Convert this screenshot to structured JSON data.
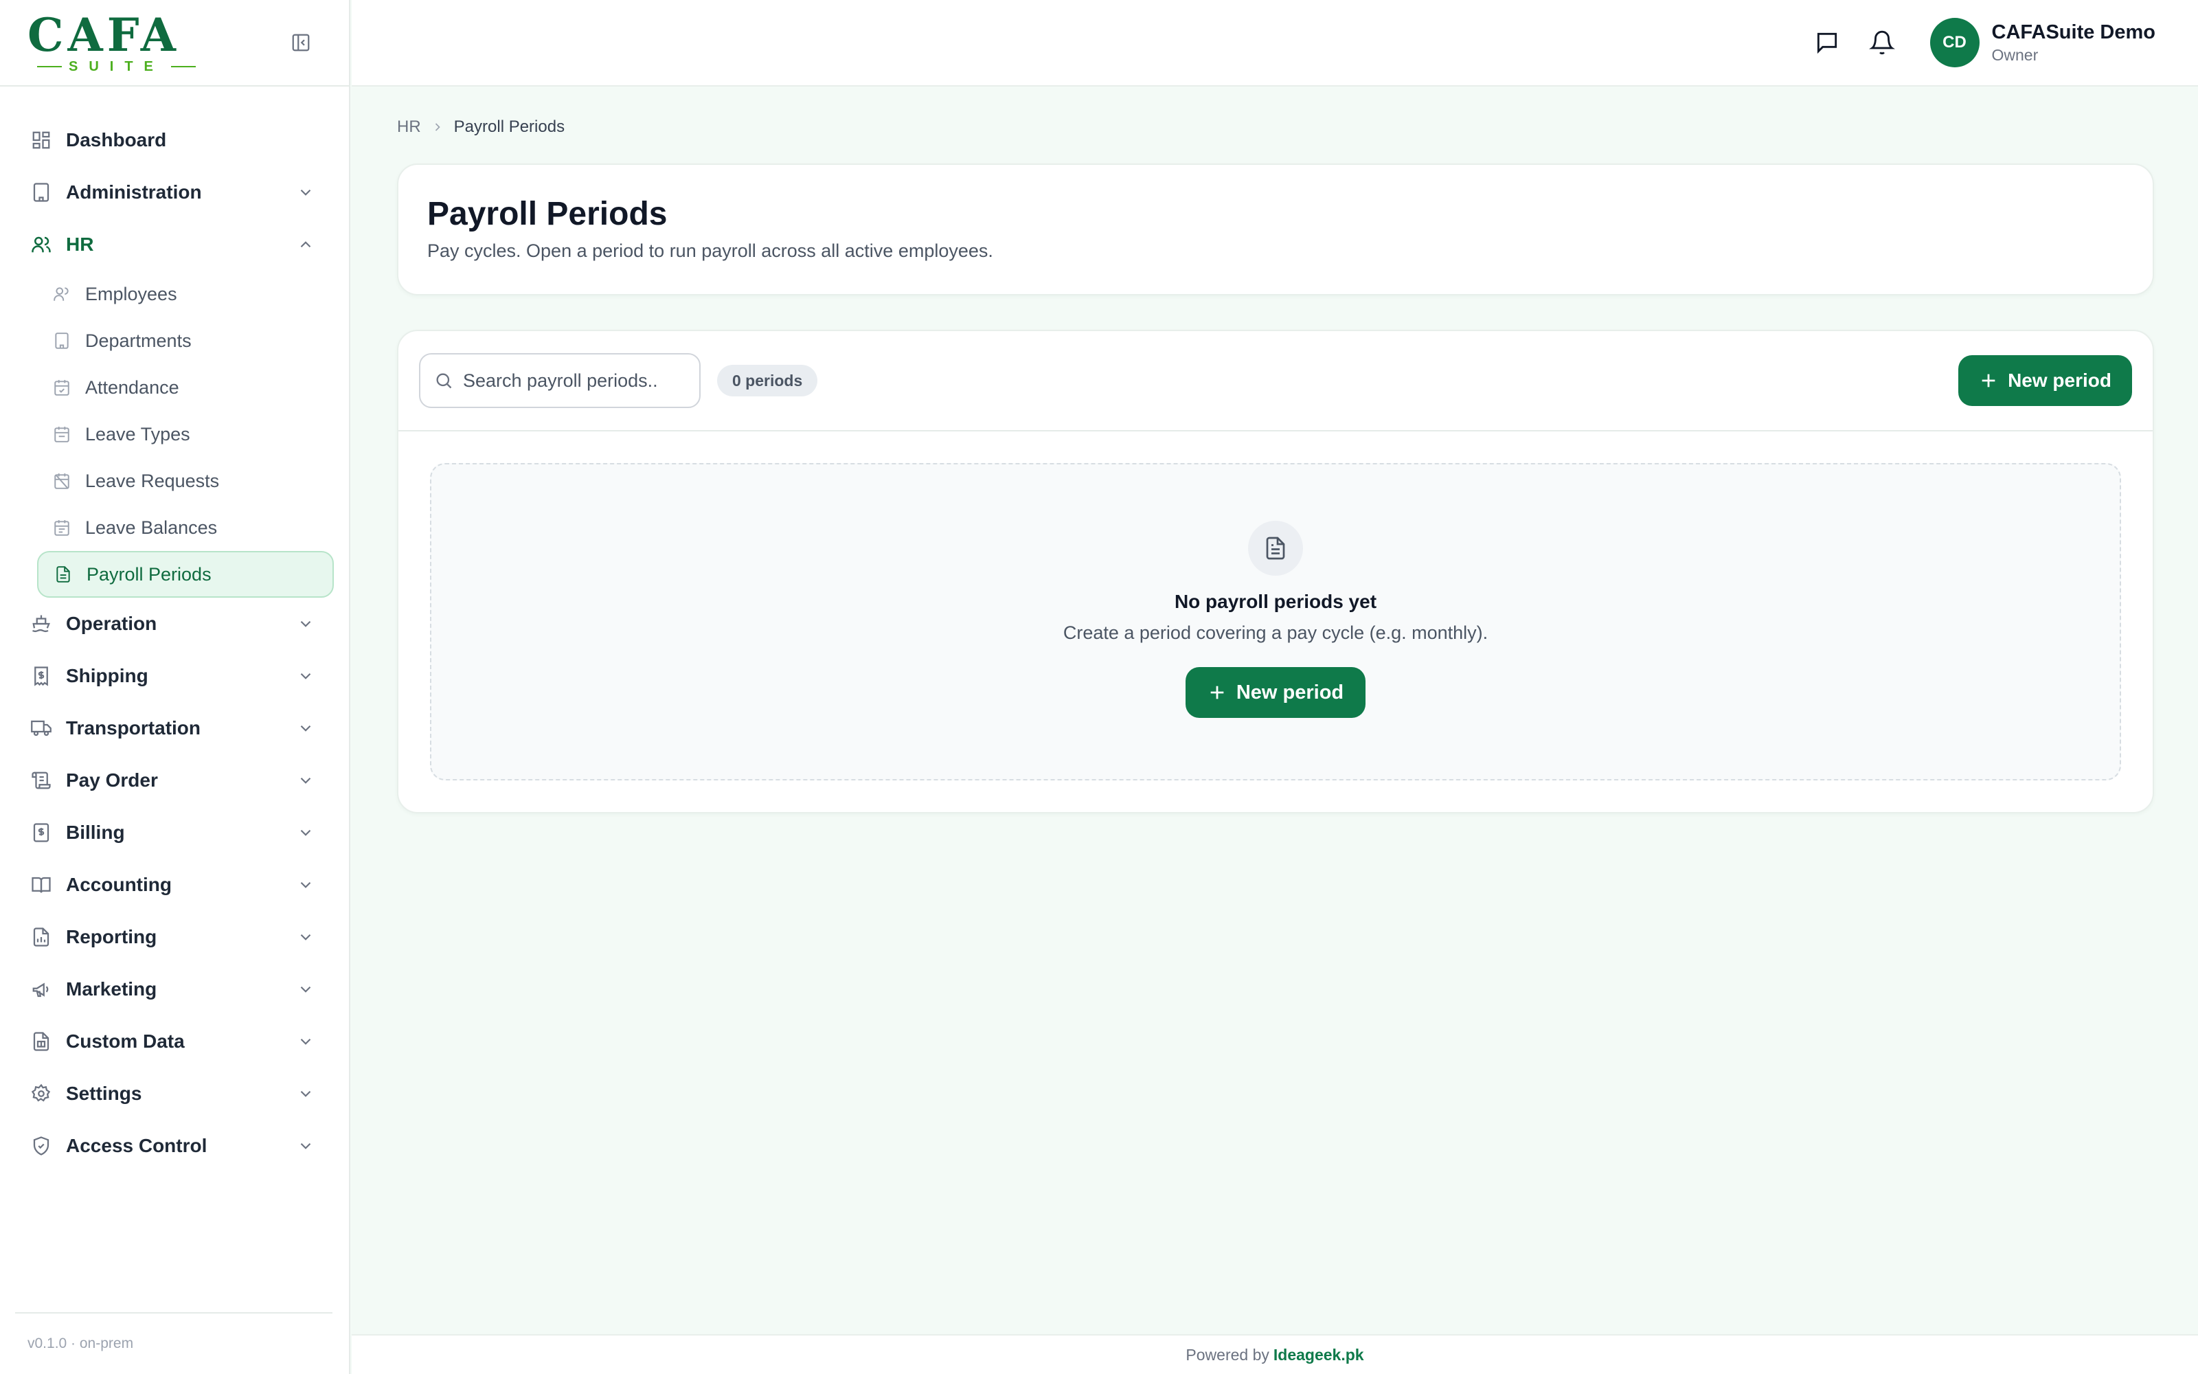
{
  "brand": {
    "logo_text": "CAFA",
    "logo_subtext": "SUITE",
    "accent": "#0f7a4a"
  },
  "sidebar": {
    "collapse_icon": "sidebar-collapse-icon",
    "items": [
      {
        "label": "Dashboard",
        "icon": "dashboard-icon"
      },
      {
        "label": "Administration",
        "icon": "building-icon"
      },
      {
        "label": "HR",
        "icon": "users-icon",
        "expanded": true,
        "children": [
          {
            "label": "Employees",
            "icon": "user-icon"
          },
          {
            "label": "Departments",
            "icon": "building-icon"
          },
          {
            "label": "Attendance",
            "icon": "calendar-check-icon"
          },
          {
            "label": "Leave Types",
            "icon": "calendar-icon"
          },
          {
            "label": "Leave Requests",
            "icon": "calendar-off-icon"
          },
          {
            "label": "Leave Balances",
            "icon": "calendar-icon"
          },
          {
            "label": "Payroll Periods",
            "icon": "file-text-icon",
            "active": true
          }
        ]
      },
      {
        "label": "Operation",
        "icon": "ship-icon"
      },
      {
        "label": "Shipping",
        "icon": "receipt-icon"
      },
      {
        "label": "Transportation",
        "icon": "truck-icon"
      },
      {
        "label": "Pay Order",
        "icon": "scroll-icon"
      },
      {
        "label": "Billing",
        "icon": "billing-icon"
      },
      {
        "label": "Accounting",
        "icon": "book-icon"
      },
      {
        "label": "Reporting",
        "icon": "report-icon"
      },
      {
        "label": "Marketing",
        "icon": "megaphone-icon"
      },
      {
        "label": "Custom Data",
        "icon": "custom-data-icon"
      },
      {
        "label": "Settings",
        "icon": "gear-icon"
      },
      {
        "label": "Access Control",
        "icon": "shield-icon"
      }
    ],
    "version": "v0.1.0 · on-prem"
  },
  "topbar": {
    "messages_icon": "message-icon",
    "notifications_icon": "bell-icon",
    "user": {
      "initials": "CD",
      "name": "CAFASuite Demo",
      "role": "Owner"
    }
  },
  "breadcrumb": {
    "parent": "HR",
    "current": "Payroll Periods"
  },
  "page": {
    "title": "Payroll Periods",
    "subtitle": "Pay cycles. Open a period to run payroll across all active employees."
  },
  "toolbar": {
    "search_placeholder": "Search payroll periods..",
    "search_value": "",
    "count_badge": "0 periods",
    "new_button": "New period"
  },
  "empty_state": {
    "icon": "file-text-icon",
    "title": "No payroll periods yet",
    "subtitle": "Create a period covering a pay cycle (e.g. monthly).",
    "button": "New period"
  },
  "footer": {
    "prefix": "Powered by",
    "link": "Ideageek.pk"
  }
}
